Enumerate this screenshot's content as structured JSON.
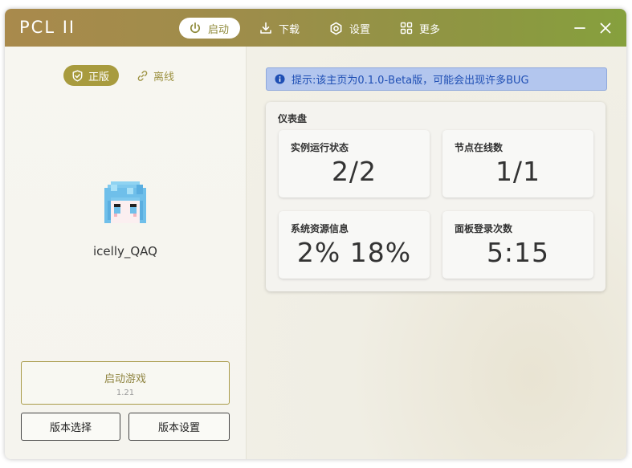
{
  "app": {
    "title": "PCL II"
  },
  "nav": {
    "launch": "启动",
    "download": "下载",
    "settings": "设置",
    "more": "更多"
  },
  "account": {
    "mode_premium": "正版",
    "mode_offline": "离线",
    "username": "icelly_QAQ"
  },
  "actions": {
    "launch_title": "启动游戏",
    "launch_version": "1.21",
    "version_select": "版本选择",
    "version_settings": "版本设置"
  },
  "notice": {
    "text": "提示:该主页为0.1.0-Beta版，可能会出现许多BUG"
  },
  "dashboard": {
    "title": "仪表盘",
    "cards": [
      {
        "title": "实例运行状态",
        "value": "2/2"
      },
      {
        "title": "节点在线数",
        "value": "1/1"
      },
      {
        "title": "系统资源信息",
        "value": "2% 18%"
      },
      {
        "title": "面板登录次数",
        "value": "5:15"
      }
    ]
  },
  "colors": {
    "accent": "#a89b3e",
    "titlebar_start": "#a98a4c",
    "titlebar_end": "#86a03d",
    "notice_bg": "#b3c6ee",
    "notice_text": "#1f4fb4"
  },
  "icons": {
    "launch": "power-icon",
    "download": "download-icon",
    "settings": "gear-icon",
    "more": "grid-icon",
    "premium": "shield-check-icon",
    "offline": "link-icon",
    "notice": "info-icon"
  }
}
